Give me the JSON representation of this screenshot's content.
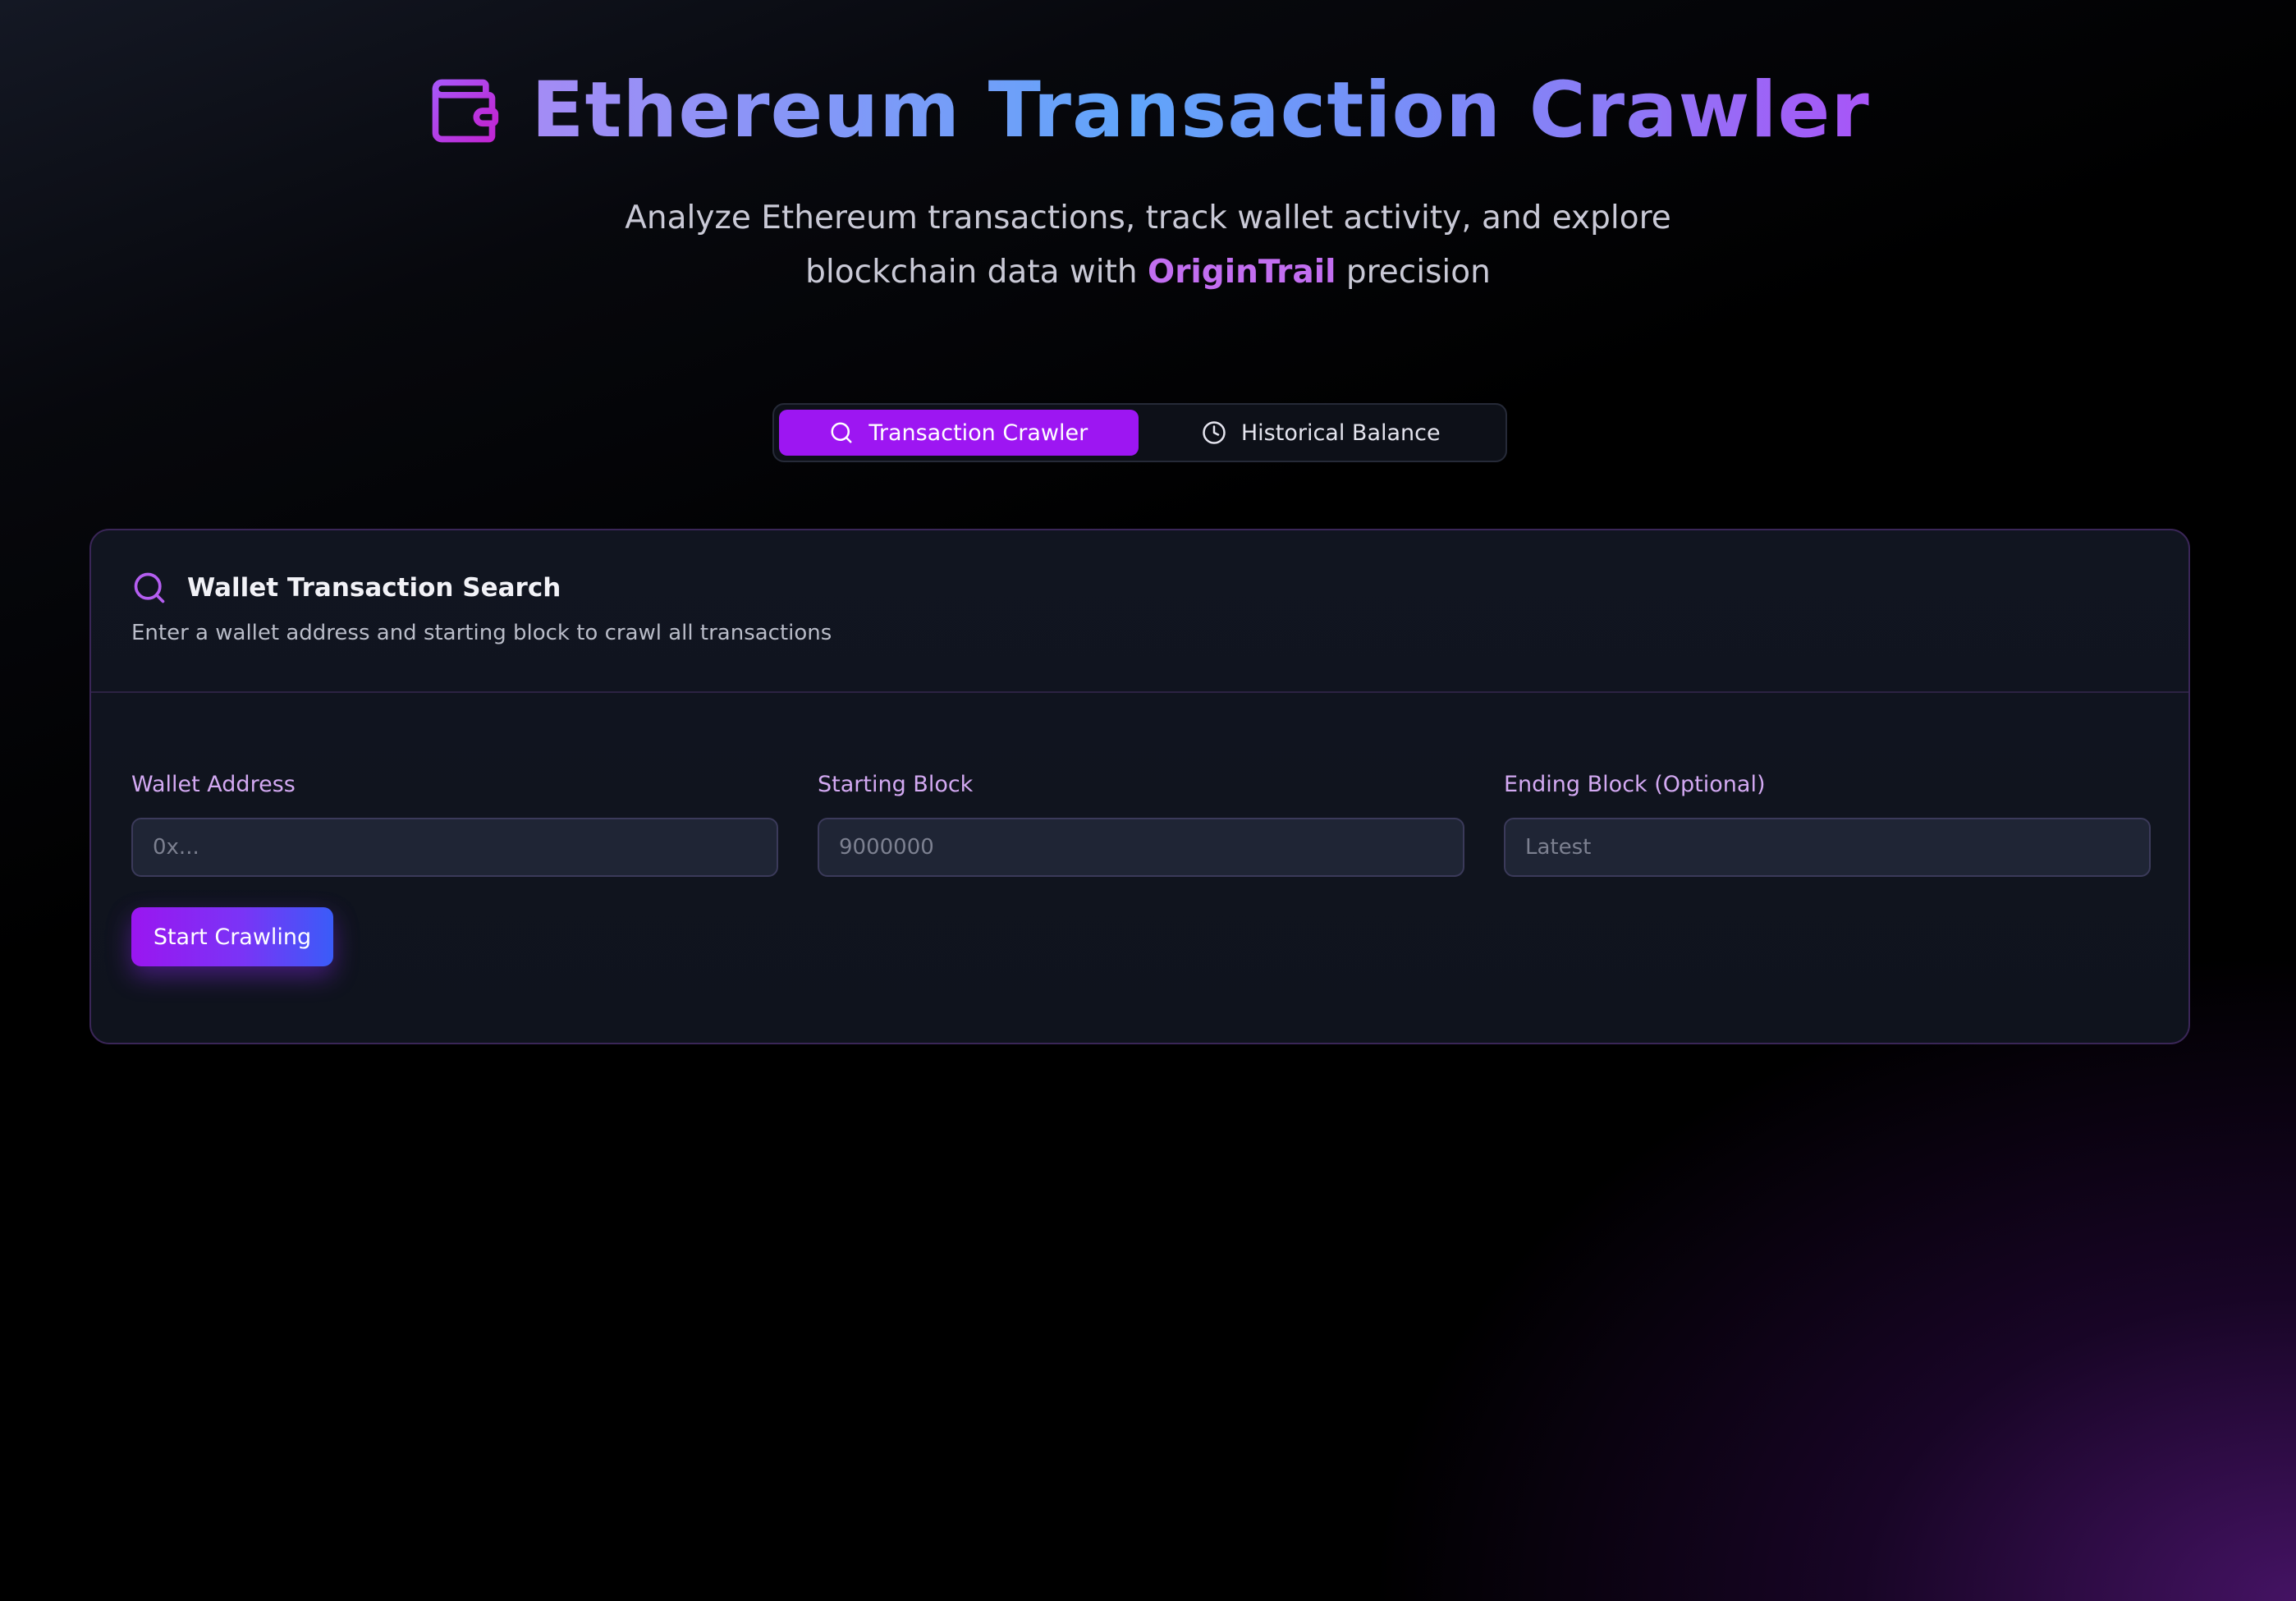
{
  "header": {
    "title": "Ethereum Transaction Crawler",
    "title_icon": "wallet-icon",
    "subtitle_line1": "Analyze Ethereum transactions, track wallet activity, and explore",
    "subtitle_line2_prefix": "blockchain data with ",
    "subtitle_brand": "OriginTrail",
    "subtitle_line2_suffix": " precision"
  },
  "tabs": [
    {
      "label": "Transaction Crawler",
      "icon": "search-icon",
      "active": true
    },
    {
      "label": "Historical Balance",
      "icon": "clock-icon",
      "active": false
    }
  ],
  "card": {
    "icon": "search-icon",
    "title": "Wallet Transaction Search",
    "description": "Enter a wallet address and starting block to crawl all transactions",
    "fields": [
      {
        "label": "Wallet Address",
        "placeholder": "0x...",
        "value": ""
      },
      {
        "label": "Starting Block",
        "placeholder": "9000000",
        "value": ""
      },
      {
        "label": "Ending Block (Optional)",
        "placeholder": "Latest",
        "value": ""
      }
    ],
    "submit_label": "Start Crawling"
  },
  "colors": {
    "accent_purple": "#9d16f2",
    "brand_text": "#c26ef0",
    "label_text": "#d3a9f2",
    "accent_blue": "#3a5cf8"
  }
}
